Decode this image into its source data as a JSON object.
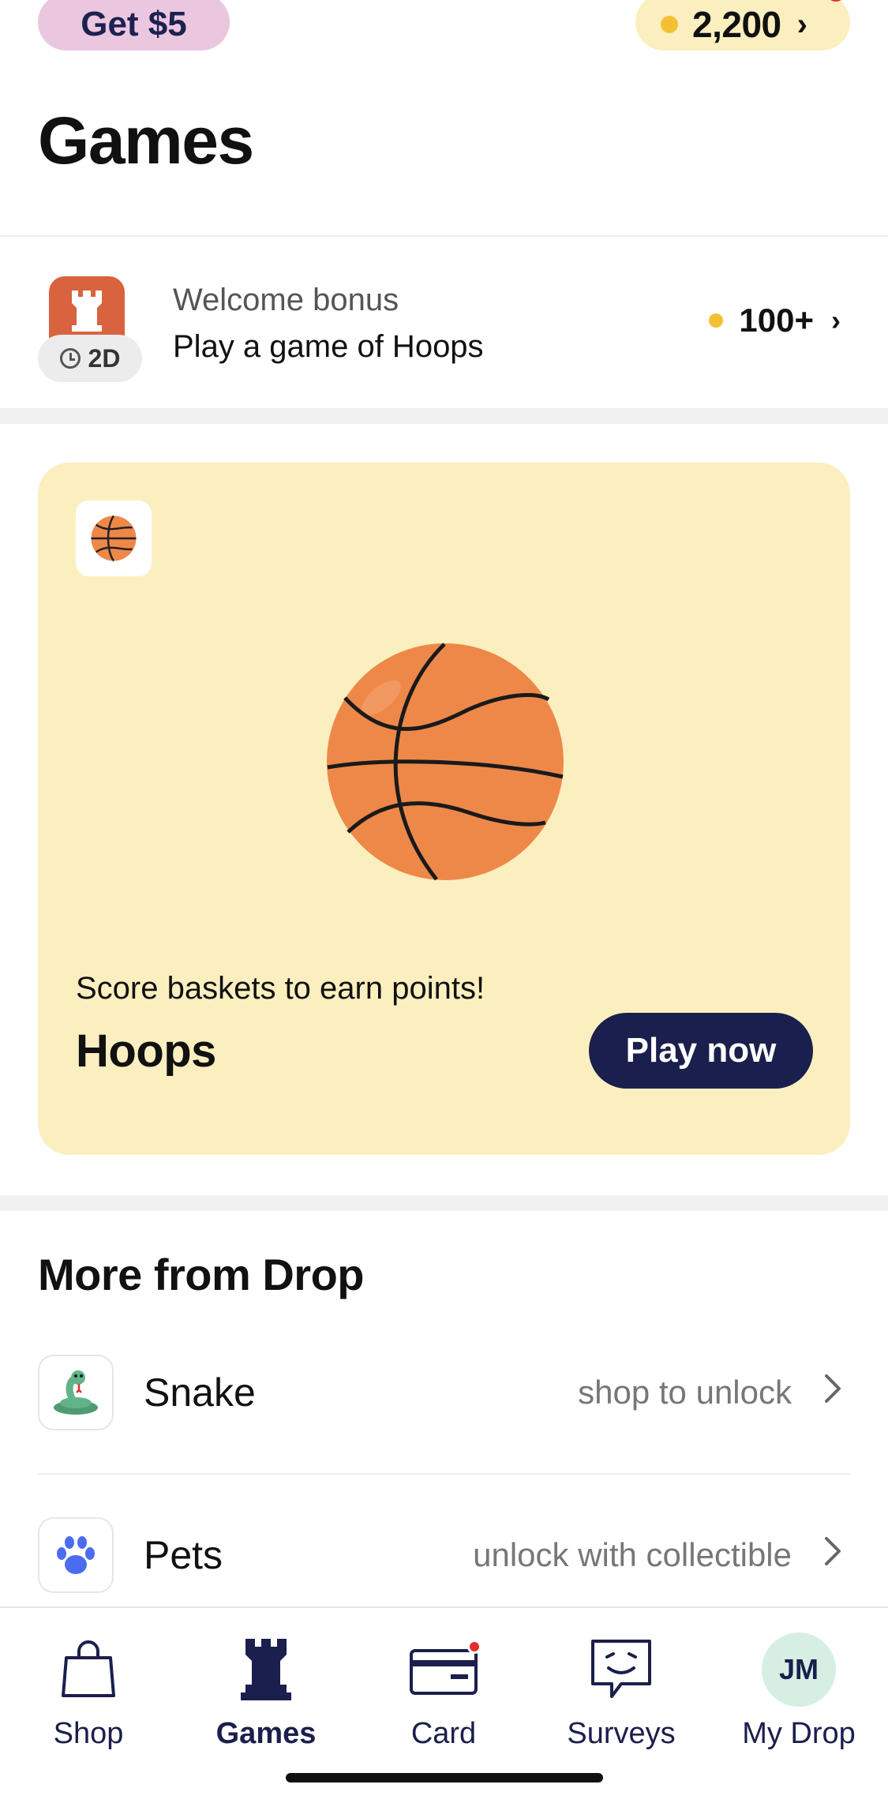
{
  "header": {
    "referral_label": "Get $5",
    "points_balance": "2,200",
    "points_chevron": "›",
    "has_notification": true
  },
  "page": {
    "title": "Games"
  },
  "bonus": {
    "label": "Welcome bonus",
    "description": "Play a game of Hoops",
    "time_badge": "2D",
    "points": "100+",
    "chevron": "›",
    "icon": "rook-icon"
  },
  "featured_game": {
    "icon": "basketball-icon",
    "subtitle": "Score baskets to earn points!",
    "title": "Hoops",
    "button_label": "Play now",
    "background_color": "#fbefbf",
    "button_color": "#1b1f4d"
  },
  "more": {
    "section_title": "More from Drop",
    "games": [
      {
        "name": "Snake",
        "status": "shop to unlock",
        "icon": "snake-icon"
      },
      {
        "name": "Pets",
        "status": "unlock with collectible",
        "icon": "paw-icon"
      }
    ]
  },
  "tabbar": {
    "tabs": [
      {
        "label": "Shop",
        "icon": "shopping-bag-icon",
        "active": false
      },
      {
        "label": "Games",
        "icon": "rook-icon",
        "active": true
      },
      {
        "label": "Card",
        "icon": "card-icon",
        "active": false,
        "has_notification": true
      },
      {
        "label": "Surveys",
        "icon": "chat-smile-icon",
        "active": false
      },
      {
        "label": "My Drop",
        "icon": "avatar",
        "active": false,
        "avatar_initials": "JM"
      }
    ]
  },
  "colors": {
    "navy": "#1b1f4d",
    "coin": "#f4c033",
    "referral_pill": "#ebc6df",
    "points_pill": "#fbefbf",
    "notification": "#e0302a",
    "bonus_icon": "#d9623f"
  }
}
